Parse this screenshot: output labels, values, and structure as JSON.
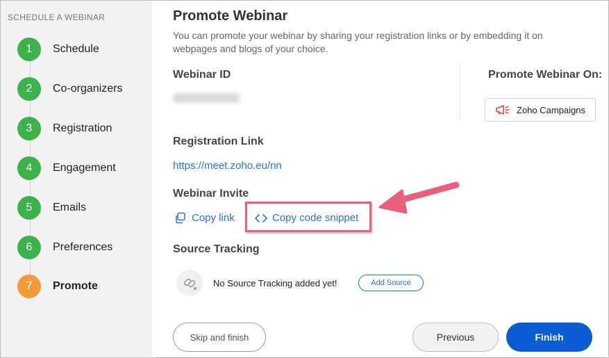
{
  "sidebar": {
    "header": "SCHEDULE A WEBINAR",
    "steps": [
      {
        "number": "1",
        "label": "Schedule"
      },
      {
        "number": "2",
        "label": "Co-organizers"
      },
      {
        "number": "3",
        "label": "Registration"
      },
      {
        "number": "4",
        "label": "Engagement"
      },
      {
        "number": "5",
        "label": "Emails"
      },
      {
        "number": "6",
        "label": "Preferences"
      },
      {
        "number": "7",
        "label": "Promote"
      }
    ],
    "active_step": "Promote"
  },
  "main": {
    "title": "Promote Webinar",
    "description": "You can promote your webinar by sharing your registration links or by embedding it on webpages and blogs of your choice.",
    "webinar_id_label": "Webinar ID",
    "promote_on_label": "Promote Webinar On:",
    "zoho_campaigns_label": "Zoho Campaigns",
    "registration_link_label": "Registration Link",
    "registration_link": "https://meet.zoho.eu/nn",
    "webinar_invite_label": "Webinar Invite",
    "copy_link_label": "Copy link",
    "copy_code_label": "Copy code snippet",
    "source_tracking_label": "Source Tracking",
    "source_tracking_empty": "No Source Tracking added yet!",
    "add_source_label": "Add Source"
  },
  "footer": {
    "skip_label": "Skip and finish",
    "previous_label": "Previous",
    "finish_label": "Finish"
  },
  "colors": {
    "step_done": "#3bb24a",
    "step_active": "#f39a3a",
    "link": "#2b73d8",
    "primary": "#0b5bd3",
    "annotation": "#eb5f7a"
  }
}
